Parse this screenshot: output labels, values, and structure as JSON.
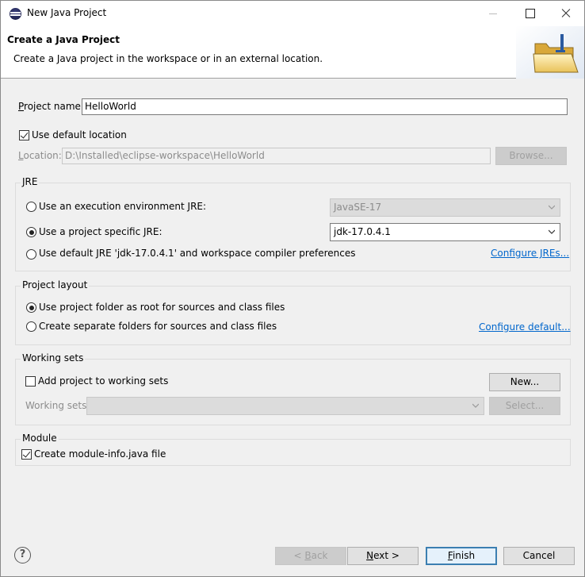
{
  "window": {
    "title": "New Java Project"
  },
  "banner": {
    "title": "Create a Java Project",
    "description": "Create a Java project in the workspace or in an external location.",
    "graphic_icon": "new-java-project-folder-icon"
  },
  "project": {
    "name_label_u": "P",
    "name_label_rest": "roject name:",
    "name_value": "HelloWorld",
    "use_default_location_label": "Use default location",
    "use_default_location_checked": true,
    "location_label_u": "L",
    "location_label_rest": "ocation:",
    "location_value": "D:\\Installed\\eclipse-workspace\\HelloWorld",
    "browse_label": "Browse..."
  },
  "jre": {
    "group_title": "JRE",
    "option_env_label": "Use an execution environment JRE:",
    "option_env_value": "JavaSE-17",
    "option_specific_label": "Use a project specific JRE:",
    "option_specific_value": "jdk-17.0.4.1",
    "option_default_label": "Use default JRE 'jdk-17.0.4.1' and workspace compiler preferences",
    "configure_link": "Configure JREs...",
    "selected": "specific"
  },
  "layout": {
    "group_title": "Project layout",
    "option_root_label": "Use project folder as root for sources and class files",
    "option_separate_label": "Create separate folders for sources and class files",
    "configure_link": "Configure default...",
    "selected": "root"
  },
  "working_sets": {
    "group_title": "Working sets",
    "add_label": "Add project to working sets",
    "add_checked": false,
    "new_button": "New...",
    "label": "Working sets:",
    "select_button": "Select..."
  },
  "module": {
    "group_title": "Module",
    "create_label": "Create module-info.java file",
    "create_checked": true
  },
  "footer": {
    "help": "?",
    "back_u": "B",
    "back_pre": "< ",
    "back_rest": "ack",
    "next_u": "N",
    "next_rest": "ext >",
    "finish_u": "F",
    "finish_rest": "inish",
    "cancel": "Cancel"
  }
}
